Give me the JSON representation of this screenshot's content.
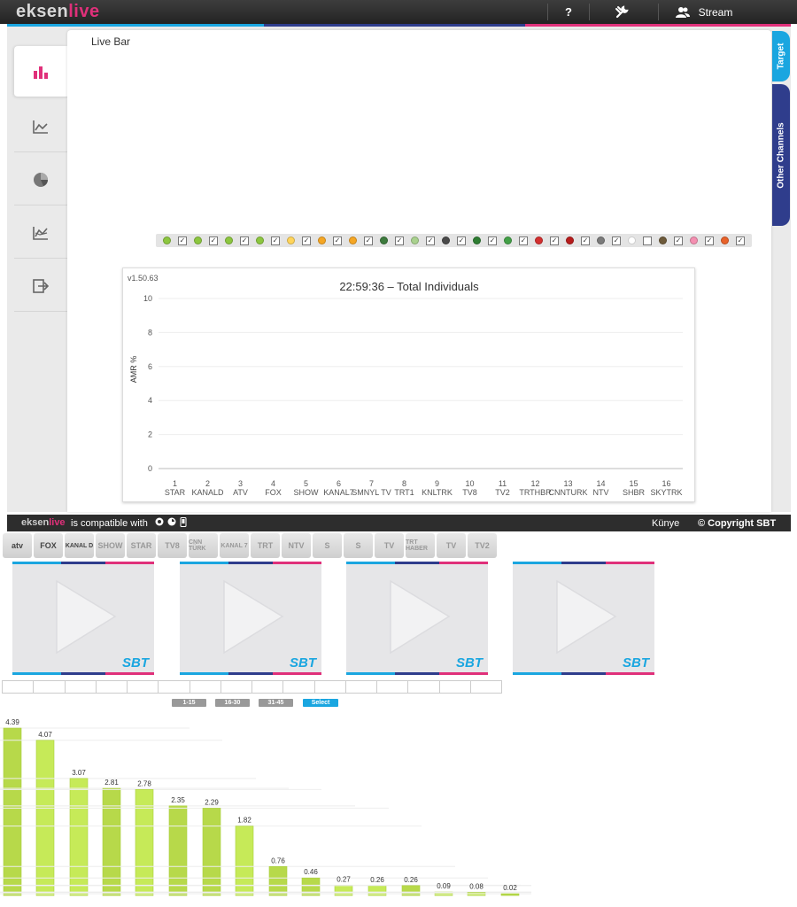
{
  "brand": {
    "part1": "eksen",
    "part2": "live"
  },
  "colors": {
    "accent_blue": "#1aa6e0",
    "accent_navy": "#2f3d8c",
    "accent_pink": "#e0307a",
    "bar_green": "#bde052"
  },
  "topnav": {
    "help_label": "?",
    "tools_icon": "wrench-icon",
    "user_icon": "users-icon",
    "stream_label": "Stream"
  },
  "sidebar": {
    "items": [
      {
        "icon": "bar-chart-icon",
        "active": true
      },
      {
        "icon": "line-chart-icon",
        "active": false
      },
      {
        "icon": "pie-chart-icon",
        "active": false
      },
      {
        "icon": "trend-chart-icon",
        "active": false
      },
      {
        "icon": "export-icon",
        "active": false
      }
    ]
  },
  "panel": {
    "title": "Live Bar"
  },
  "right_tabs": {
    "target": "Target",
    "other": "Other Channels"
  },
  "legend_colors": [
    "#8cc63f",
    "#8cc63f",
    "#8cc63f",
    "#8cc63f",
    "#ffd45a",
    "#f5a623",
    "#f5a623",
    "#3d7a3d",
    "#a9d18e",
    "#4a4a4a",
    "#2e7d32",
    "#43a047",
    "#d32f2f",
    "#b71c1c",
    "#7a7a7a",
    "#ffffff",
    "#6d5a3a",
    "#f48fb1",
    "#e8622a"
  ],
  "chart_data": {
    "type": "bar",
    "version": "v1.50.63",
    "title": "22:59:36 – Total Individuals",
    "ylabel": "AMR %",
    "ylim": [
      0,
      10
    ],
    "yticks": [
      "0",
      "2",
      "4",
      "6",
      "8",
      "10"
    ],
    "categories": [
      {
        "num": "1",
        "name": "STAR"
      },
      {
        "num": "2",
        "name": "KANALD"
      },
      {
        "num": "3",
        "name": "ATV"
      },
      {
        "num": "4",
        "name": "FOX"
      },
      {
        "num": "5",
        "name": "SHOW"
      },
      {
        "num": "6",
        "name": "KANAL7"
      },
      {
        "num": "7",
        "name": "SMNYL TV"
      },
      {
        "num": "8",
        "name": "TRT1"
      },
      {
        "num": "9",
        "name": "KNLTRK"
      },
      {
        "num": "10",
        "name": "TV8"
      },
      {
        "num": "11",
        "name": "TV2"
      },
      {
        "num": "12",
        "name": "TRTHBR"
      },
      {
        "num": "13",
        "name": "CNNTURK"
      },
      {
        "num": "14",
        "name": "NTV"
      },
      {
        "num": "15",
        "name": "SHBR"
      },
      {
        "num": "16",
        "name": "SKYTRK"
      }
    ]
  },
  "footer": {
    "compat_text": "is compatible with",
    "kunye": "Künye",
    "copyright": "© Copyright",
    "sbt": "SBT"
  },
  "channels": [
    "atv",
    "FOX",
    "KANAL D",
    "SHOW",
    "STAR",
    "TV8",
    "CNN TÜRK",
    "KANAL 7",
    "TRT",
    "NTV",
    "S",
    "S",
    "TV",
    "TRT HABER",
    "TV",
    "TV2"
  ],
  "video": {
    "logo": "SBT"
  },
  "pager_buttons": [
    "1-15",
    "16-30",
    "31-45",
    "Select"
  ],
  "ranking_chart": {
    "type": "bar",
    "values": [
      4.39,
      4.07,
      3.07,
      2.81,
      2.78,
      2.35,
      2.29,
      1.82,
      0.76,
      0.46,
      0.27,
      0.26,
      0.26,
      0.09,
      0.08,
      0.02
    ],
    "labels": [
      "4.39",
      "4.07",
      "3.07",
      "2.81",
      "2.78",
      "2.35",
      "2.29",
      "1.82",
      "0.76",
      "0.46",
      "0.27",
      "0.26",
      "0.26",
      "0.09",
      "0.08",
      "0.02"
    ]
  }
}
